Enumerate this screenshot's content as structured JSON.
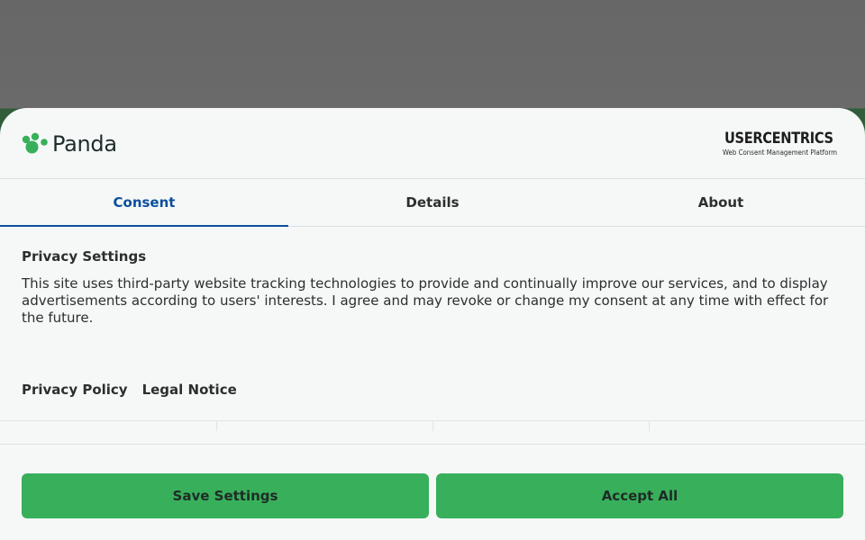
{
  "brand": {
    "name": "Panda",
    "accent_color": "#38b05b"
  },
  "provider": {
    "name": "USERCENTRICS",
    "tagline": "Web Consent Management Platform"
  },
  "tabs": [
    {
      "label": "Consent",
      "active": true
    },
    {
      "label": "Details",
      "active": false
    },
    {
      "label": "About",
      "active": false
    }
  ],
  "consent": {
    "title": "Privacy Settings",
    "description": "This site uses third-party website tracking technologies to provide and continually improve our services, and to display advertisements according to users' interests. I agree and may revoke or change my consent at any time with effect for the future."
  },
  "links": {
    "privacy_policy": "Privacy Policy",
    "legal_notice": "Legal Notice"
  },
  "buttons": {
    "save": "Save Settings",
    "accept": "Accept All"
  },
  "colors": {
    "active_tab": "#0b4f9c",
    "button": "#38b05b"
  }
}
